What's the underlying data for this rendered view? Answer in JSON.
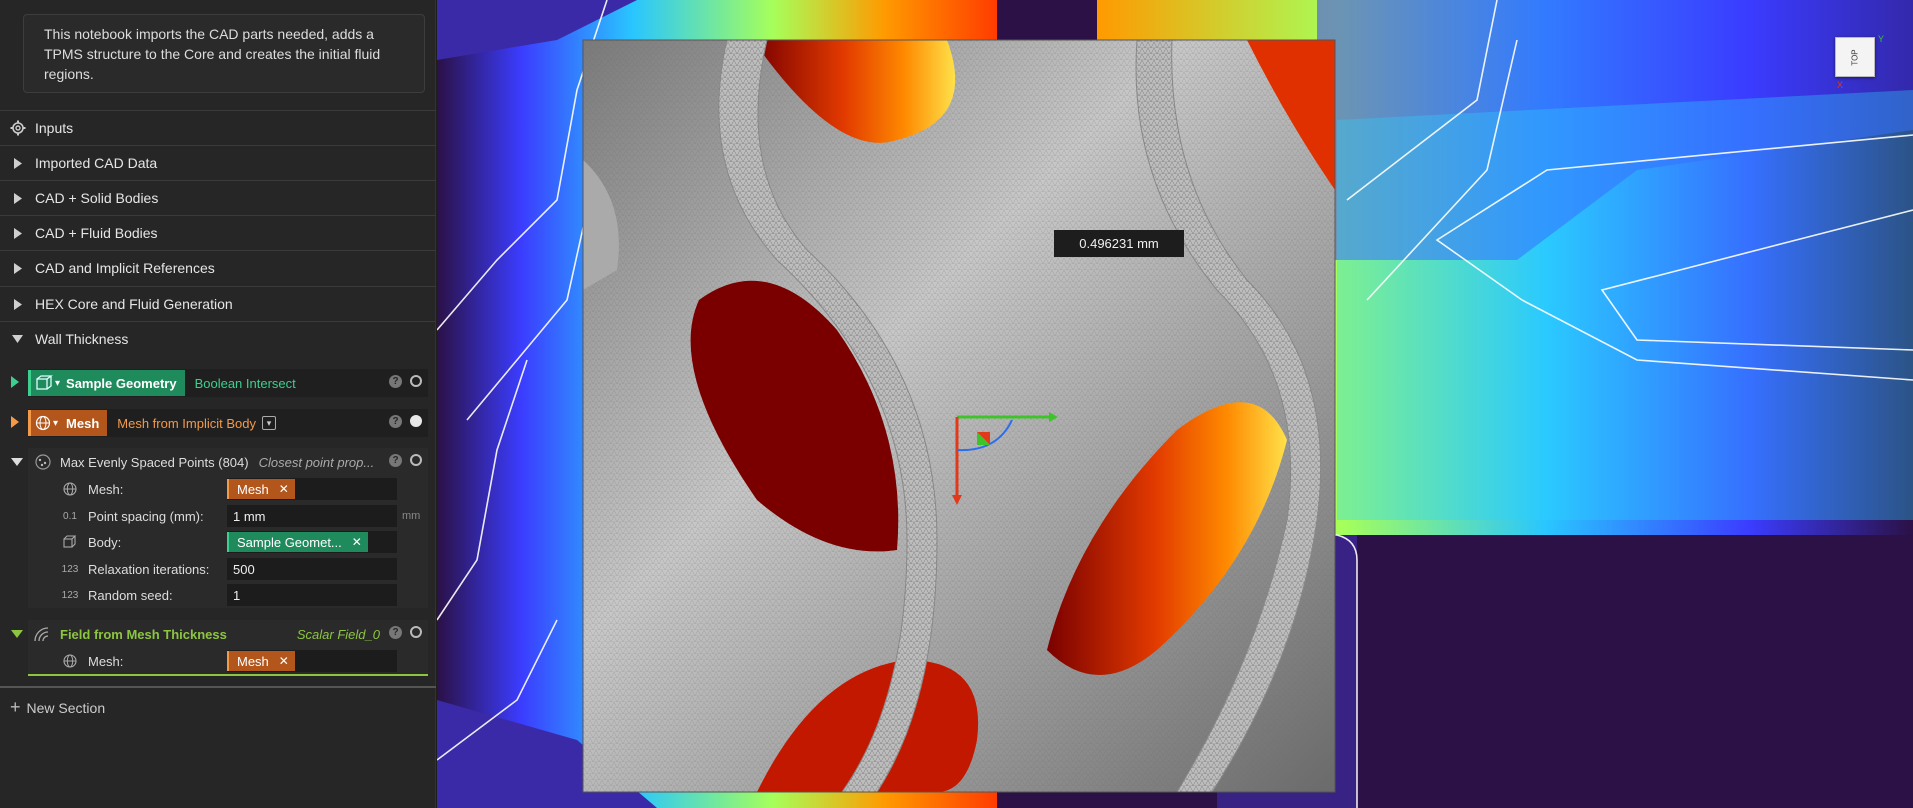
{
  "description": "This notebook imports the CAD parts needed, adds a TPMS structure to the Core and creates the initial fluid regions.",
  "sections": [
    {
      "label": "Inputs"
    },
    {
      "label": "Imported CAD Data"
    },
    {
      "label": "CAD + Solid Bodies"
    },
    {
      "label": "CAD + Fluid Bodies"
    },
    {
      "label": "CAD and Implicit References"
    },
    {
      "label": "HEX Core and Fluid Generation"
    },
    {
      "label": "Wall Thickness"
    }
  ],
  "nodes": {
    "sample_geometry": {
      "name": "Sample Geometry",
      "type": "Boolean Intersect",
      "color": "#1f8a5c",
      "type_color": "#3ccf8e"
    },
    "mesh": {
      "name": "Mesh",
      "type": "Mesh from Implicit Body",
      "color": "#b3561c",
      "type_color": "#f29a4a"
    },
    "max_points": {
      "name": "Max Evenly Spaced Points (804)",
      "type": "Closest point prop...",
      "params": [
        {
          "label": "Mesh:",
          "icon": "globe-icon",
          "value": "Mesh",
          "kind": "chip",
          "chip_color": "#b3561c"
        },
        {
          "label": "Point spacing (mm):",
          "icon": "0.1",
          "value": "1 mm",
          "kind": "text",
          "unit": "mm"
        },
        {
          "label": "Body:",
          "icon": "body-icon",
          "value": "Sample Geomet...",
          "kind": "chip",
          "chip_color": "#1f8a5c"
        },
        {
          "label": "Relaxation iterations:",
          "icon": "123",
          "value": "500",
          "kind": "text"
        },
        {
          "label": "Random seed:",
          "icon": "123",
          "value": "1",
          "kind": "text"
        }
      ]
    },
    "field_thickness": {
      "name": "Field from Mesh Thickness",
      "type": "Scalar Field_0",
      "color": "#8cc63f",
      "params": [
        {
          "label": "Mesh:",
          "icon": "globe-icon",
          "value": "Mesh",
          "kind": "chip",
          "chip_color": "#b3561c"
        }
      ]
    }
  },
  "new_section": "New Section",
  "viewport": {
    "measurement": "0.496231 mm",
    "view_cube": "TOP",
    "axes": {
      "y": "Y",
      "x": "X"
    }
  }
}
